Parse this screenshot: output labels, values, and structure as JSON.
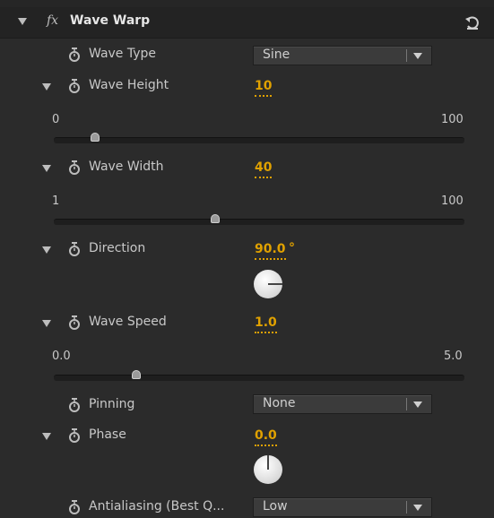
{
  "effect": {
    "title": "Wave Warp",
    "fx": "fx"
  },
  "props": {
    "wave_type": {
      "label": "Wave Type",
      "value": "Sine"
    },
    "wave_height": {
      "label": "Wave Height",
      "value": "10",
      "min": "0",
      "max": "100",
      "level": 0.1
    },
    "wave_width": {
      "label": "Wave Width",
      "value": "40",
      "min": "1",
      "max": "100",
      "level": 0.394
    },
    "direction": {
      "label": "Direction",
      "value": "90.0",
      "unit": "°"
    },
    "wave_speed": {
      "label": "Wave Speed",
      "value": "1.0",
      "min": "0.0",
      "max": "5.0",
      "level": 0.2
    },
    "pinning": {
      "label": "Pinning",
      "value": "None"
    },
    "phase": {
      "label": "Phase",
      "value": "0.0"
    },
    "antialiasing": {
      "label": "Antialiasing (Best Q...",
      "value": "Low"
    }
  },
  "icons": {
    "reset": "reset-icon",
    "stopwatch": "stopwatch-icon",
    "twirl": "twirl-down-icon"
  },
  "colors": {
    "value": "#e0a100",
    "background": "#2b2b2b",
    "header": "#232323"
  }
}
